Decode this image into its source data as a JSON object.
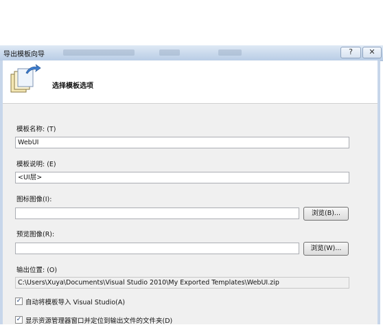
{
  "window": {
    "title": "导出模板向导",
    "help_glyph": "?",
    "close_glyph": "✕"
  },
  "header": {
    "title": "选择模板选项"
  },
  "form": {
    "name_label": "模板名称: (T)",
    "name_value": "WebUI",
    "desc_label": "模板说明: (E)",
    "desc_value": "<UI层>",
    "icon_label": "图标图像(I):",
    "icon_value": "",
    "icon_browse": "浏览(B)...",
    "preview_label": "预览图像(R):",
    "preview_value": "",
    "preview_browse": "浏览(W)...",
    "output_label": "输出位置: (O)",
    "output_value": "C:\\Users\\Xuya\\Documents\\Visual Studio 2010\\My Exported Templates\\WebUI.zip",
    "auto_import_label": "自动将模板导入 Visual Studio(A)",
    "auto_import_checked": true,
    "show_explorer_label": "显示资源管理器窗口并定位到输出文件的文件夹(D)",
    "show_explorer_checked": true
  }
}
